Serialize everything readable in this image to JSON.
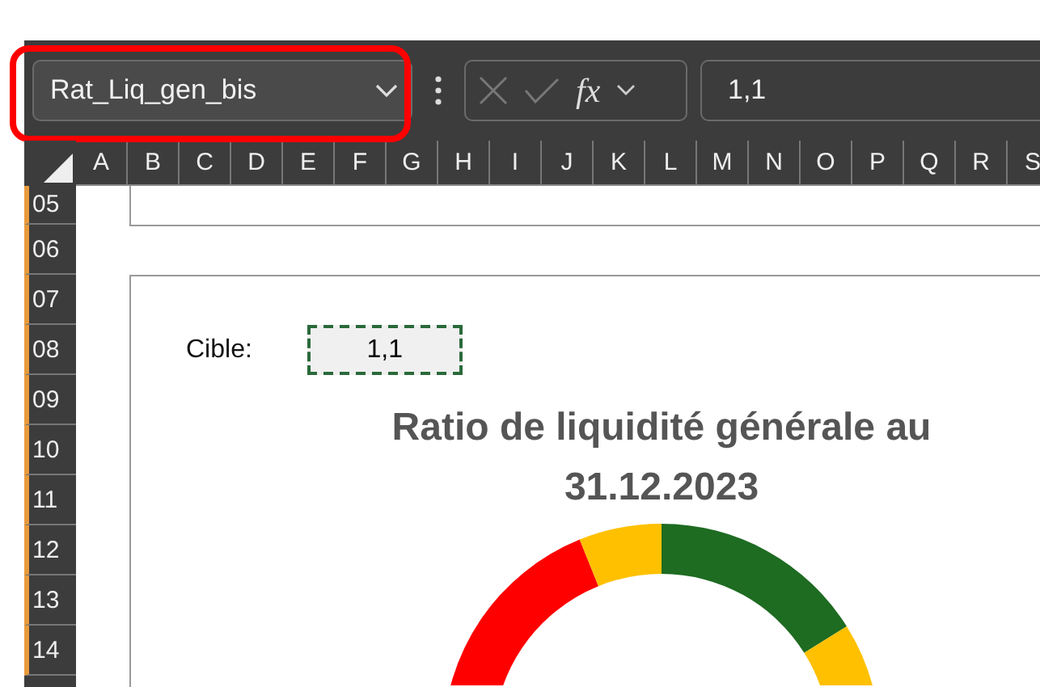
{
  "name_box": {
    "value": "Rat_Liq_gen_bis",
    "highlighted": true
  },
  "formula_bar": {
    "function_label": "fx",
    "value": "1,1"
  },
  "columns": [
    "A",
    "B",
    "C",
    "D",
    "E",
    "F",
    "G",
    "H",
    "I",
    "J",
    "K",
    "L",
    "M",
    "N",
    "O",
    "P",
    "Q",
    "R",
    "S"
  ],
  "rows": [
    "05",
    "06",
    "07",
    "08",
    "09",
    "10",
    "11",
    "12",
    "13",
    "14"
  ],
  "sheet": {
    "target_label": "Cible:",
    "target_value": "1,1",
    "chart_title": "Ratio de liquidité générale au 31.12.2023"
  }
}
